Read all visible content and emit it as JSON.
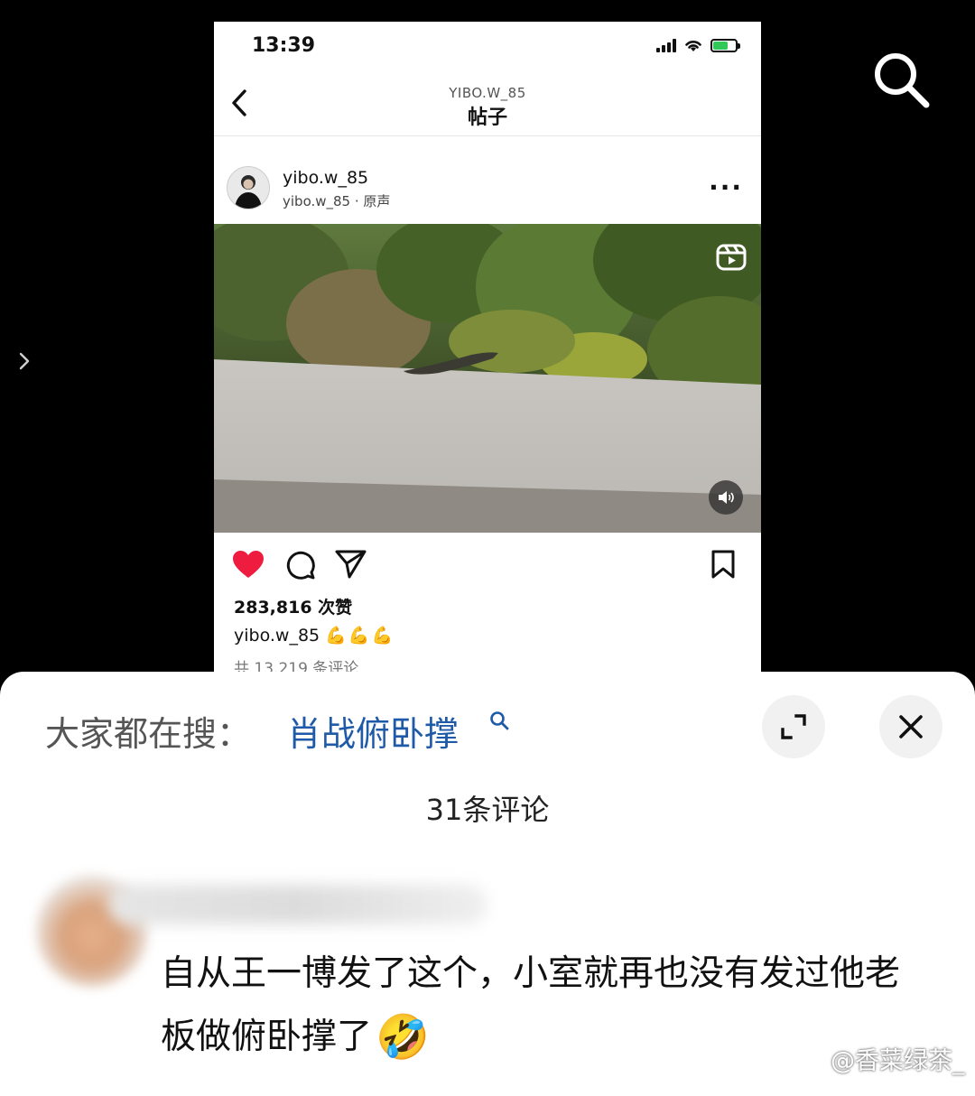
{
  "status": {
    "time": "13:39"
  },
  "nav": {
    "subtitle": "YIBO.W_85",
    "title": "帖子",
    "back_icon": "chevron-left-icon"
  },
  "post": {
    "username": "yibo.w_85",
    "audio": "yibo.w_85 · 原声",
    "more_icon": "more-icon",
    "likes": "283,816 次赞",
    "caption_user": "yibo.w_85",
    "caption_emoji": "💪💪💪",
    "comments_total": "共 13,219 条评论",
    "liked": true,
    "like_color": "#ee1c3e"
  },
  "overlay": {
    "search_icon": "search-icon",
    "next_icon": "chevron-right-icon"
  },
  "sheet": {
    "trend_prefix": "大家都在搜：",
    "trend_term": "肖战俯卧撑",
    "trend_color": "#1f5aa8",
    "comment_count": "31条评论",
    "comment_text": "自从王一博发了这个，小室就再也没有发过他老板做俯卧撑了",
    "comment_emoji": "🤣"
  },
  "watermark": "@香菜绿茶_"
}
